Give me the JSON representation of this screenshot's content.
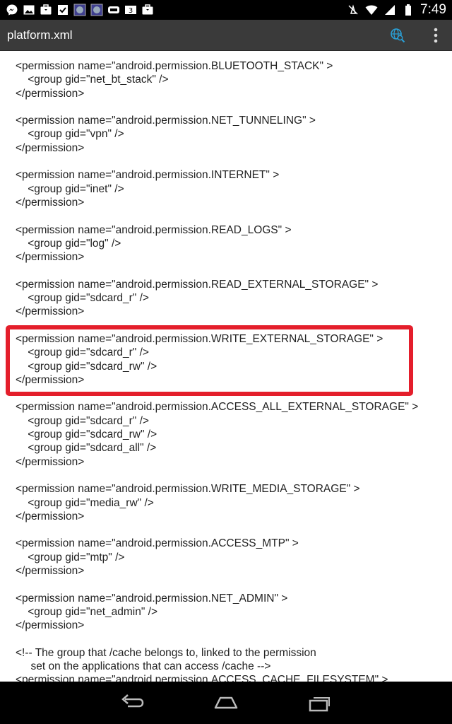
{
  "status_bar": {
    "time": "7:49",
    "icons": [
      "messenger-icon",
      "image-icon",
      "briefcase-icon",
      "checklist-icon",
      "app-icon",
      "app-icon",
      "media-icon",
      "badge-3-icon",
      "briefcase-icon"
    ],
    "right_icons": [
      "mute-icon",
      "wifi-icon",
      "signal-icon",
      "battery-icon"
    ]
  },
  "app_bar": {
    "title": "platform.xml",
    "actions": [
      "web-search-icon",
      "overflow-menu-icon"
    ],
    "accent": "#2aa1d8"
  },
  "document": {
    "lines": [
      "<permission name=\"android.permission.BLUETOOTH_STACK\" >",
      "    <group gid=\"net_bt_stack\" />",
      "</permission>",
      "",
      "<permission name=\"android.permission.NET_TUNNELING\" >",
      "    <group gid=\"vpn\" />",
      "</permission>",
      "",
      "<permission name=\"android.permission.INTERNET\" >",
      "    <group gid=\"inet\" />",
      "</permission>",
      "",
      "<permission name=\"android.permission.READ_LOGS\" >",
      "    <group gid=\"log\" />",
      "</permission>",
      "",
      "<permission name=\"android.permission.READ_EXTERNAL_STORAGE\" >",
      "    <group gid=\"sdcard_r\" />",
      "</permission>",
      "",
      "<permission name=\"android.permission.WRITE_EXTERNAL_STORAGE\" >",
      "    <group gid=\"sdcard_r\" />",
      "    <group gid=\"sdcard_rw\" />",
      "</permission>",
      "",
      "<permission name=\"android.permission.ACCESS_ALL_EXTERNAL_STORAGE\" >",
      "    <group gid=\"sdcard_r\" />",
      "    <group gid=\"sdcard_rw\" />",
      "    <group gid=\"sdcard_all\" />",
      "</permission>",
      "",
      "<permission name=\"android.permission.WRITE_MEDIA_STORAGE\" >",
      "    <group gid=\"media_rw\" />",
      "</permission>",
      "",
      "<permission name=\"android.permission.ACCESS_MTP\" >",
      "    <group gid=\"mtp\" />",
      "</permission>",
      "",
      "<permission name=\"android.permission.NET_ADMIN\" >",
      "    <group gid=\"net_admin\" />",
      "</permission>",
      "",
      "<!-- The group that /cache belongs to, linked to the permission",
      "     set on the applications that can access /cache -->",
      "<permission name=\"android.permission.ACCESS_CACHE_FILESYSTEM\" >"
    ],
    "highlight_color": "#e41e2b"
  },
  "nav_bar": {
    "buttons": [
      "back-icon",
      "home-icon",
      "recents-icon"
    ]
  }
}
